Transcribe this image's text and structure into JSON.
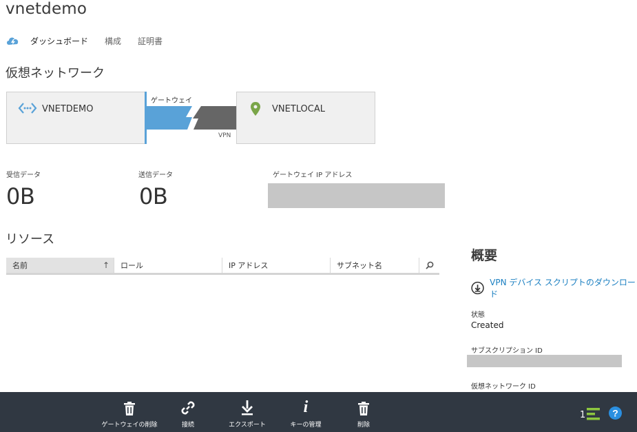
{
  "header": {
    "title": "vnetdemo"
  },
  "tabs": [
    {
      "label": "ダッシュボード"
    },
    {
      "label": "構成"
    },
    {
      "label": "証明書"
    }
  ],
  "vnet_section": {
    "title": "仮想ネットワーク",
    "local_network": "VNETDEMO",
    "remote_network": "VNETLOCAL",
    "gateway_label": "ゲートウェイ",
    "vpn_label": "VPN"
  },
  "stats": {
    "received_label": "受信データ",
    "received_value": "0B",
    "sent_label": "送信データ",
    "sent_value": "0B",
    "gateway_ip_label": "ゲートウェイ IP アドレス"
  },
  "resources": {
    "title": "リソース",
    "columns": [
      "名前",
      "ロール",
      "IP アドレス",
      "サブネット名"
    ]
  },
  "overview": {
    "title": "概要",
    "download_link": "VPN デバイス スクリプトのダウンロード",
    "status_label": "状態",
    "status_value": "Created",
    "subscription_label": "サブスクリプション ID",
    "vnet_id_label": "仮想ネットワーク ID"
  },
  "command_bar": {
    "buttons": [
      {
        "label": "ゲートウェイの削除",
        "icon": "trash-icon"
      },
      {
        "label": "接続",
        "icon": "link-icon"
      },
      {
        "label": "エクスポート",
        "icon": "download-icon"
      },
      {
        "label": "キーの管理",
        "icon": "info-icon"
      },
      {
        "label": "削除",
        "icon": "trash-icon"
      }
    ],
    "notification_count": "1"
  },
  "colors": {
    "accent_blue": "#59a2d8",
    "link_blue": "#1a7fc1",
    "location_green": "#7aa548",
    "command_bar": "#303842",
    "help_blue": "#2a8fe0",
    "notify_green": "#8cc63f"
  }
}
